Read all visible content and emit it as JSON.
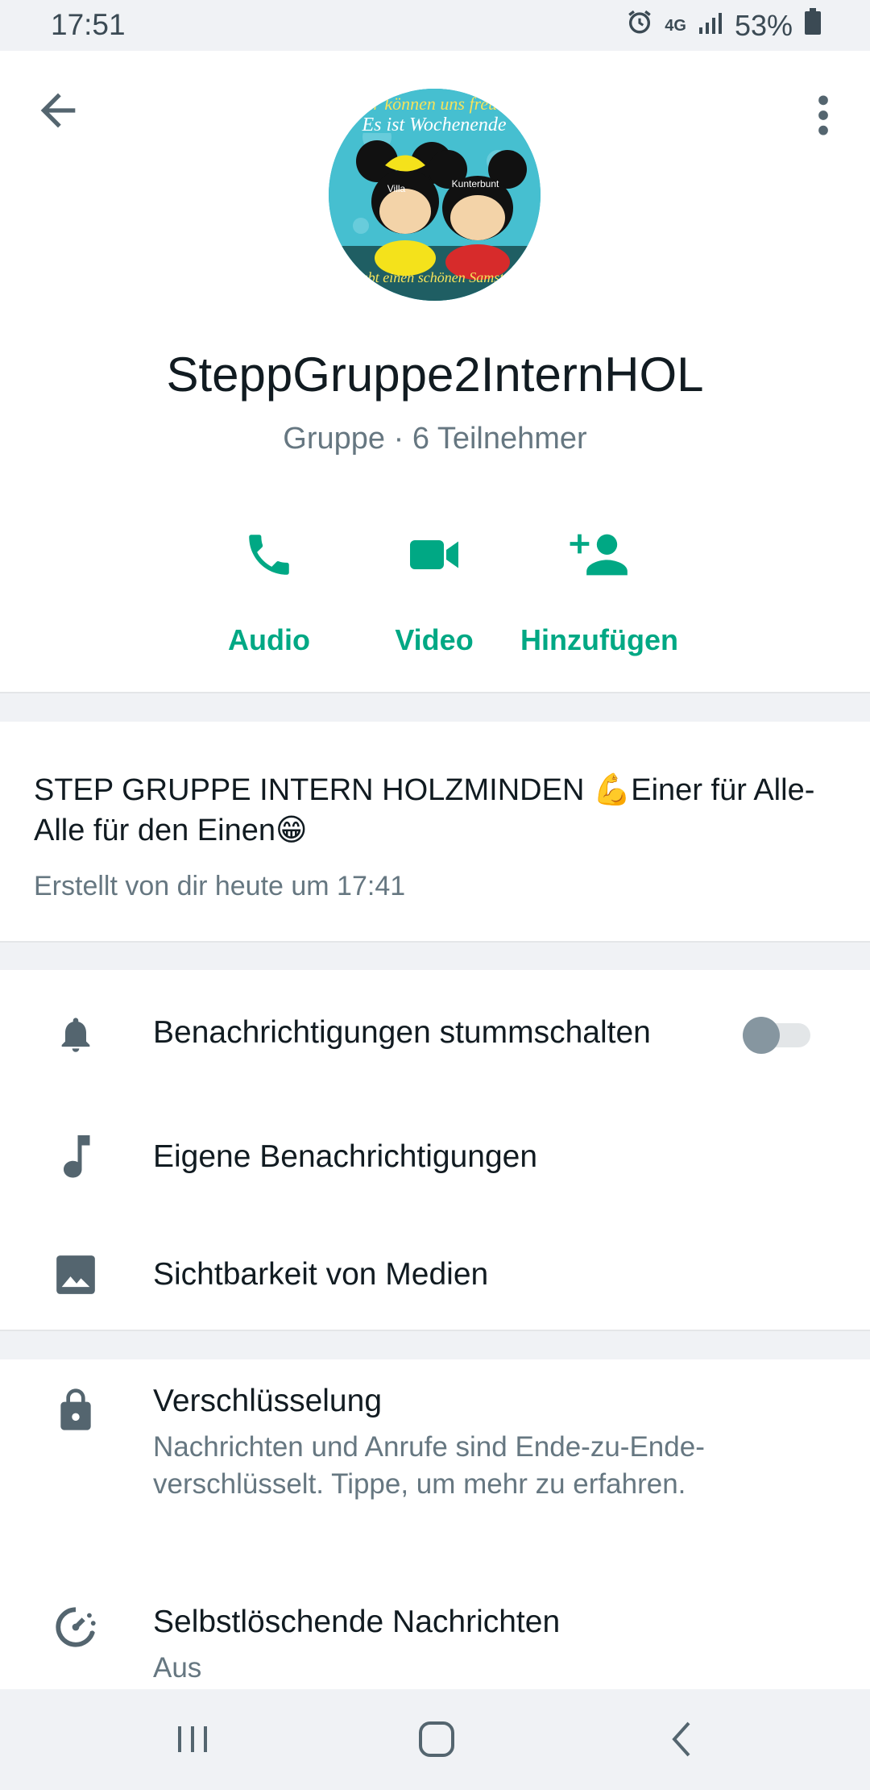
{
  "status_bar": {
    "time": "17:51",
    "network": "4G",
    "battery": "53%"
  },
  "header": {
    "group_name": "SteppGruppe2InternHOL",
    "subtitle": "Gruppe · 6 Teilnehmer",
    "avatar": {
      "line1": "Wir können uns freuen",
      "line2": "Es ist Wochenende",
      "label_left": "Villa",
      "label_right": "Kunterbunt",
      "bottom": "Habt einen schönen Samstag"
    },
    "actions": [
      {
        "label": "Audio",
        "icon": "phone-icon"
      },
      {
        "label": "Video",
        "icon": "video-icon"
      },
      {
        "label": "Hinzufügen",
        "icon": "add-person-icon"
      }
    ]
  },
  "description": {
    "text": "STEP GRUPPE INTERN HOLZMINDEN 💪Einer für Alle-Alle für den Einen😁",
    "created": "Erstellt von dir heute um 17:41"
  },
  "settings": {
    "mute_label": "Benachrichtigungen stummschalten",
    "mute_enabled": false,
    "custom_label": "Eigene Benachrichtigungen",
    "media_label": "Sichtbarkeit von Medien"
  },
  "security": {
    "encryption_title": "Verschlüsselung",
    "encryption_sub": "Nachrichten und Anrufe sind Ende-zu-Ende-verschlüsselt. Tippe, um mehr zu erfahren.",
    "disappearing_title": "Selbstlöschende Nachrichten",
    "disappearing_sub": "Aus"
  },
  "colors": {
    "accent": "#00a884",
    "icon_gray": "#54656f",
    "text_primary": "#111b21",
    "text_secondary": "#667781"
  }
}
